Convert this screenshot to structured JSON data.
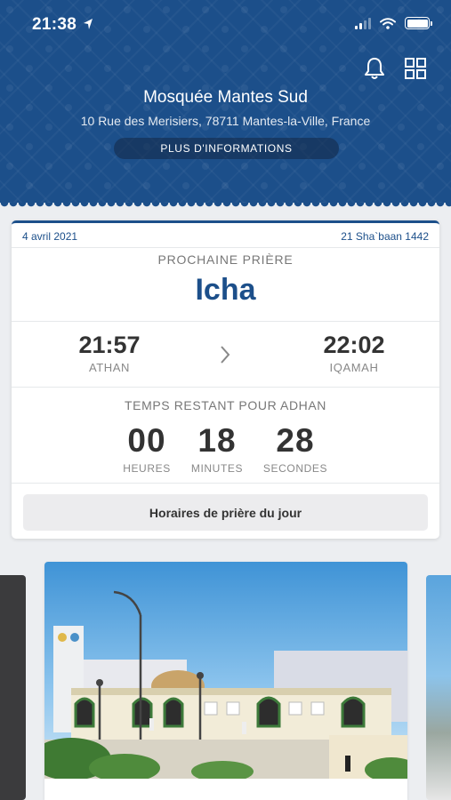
{
  "status_bar": {
    "time": "21:38"
  },
  "header": {
    "mosque_name": "Mosquée Mantes Sud",
    "address": "10 Rue des Merisiers, 78711 Mantes-la-Ville, France",
    "more_info_label": "PLUS D'INFORMATIONS",
    "icons": [
      "bell-icon",
      "grid-icon"
    ]
  },
  "prayer_card": {
    "gregorian_date": "4 avril 2021",
    "hijri_date": "21 Sha`baan 1442",
    "next_prayer_label": "PROCHAINE PRIÈRE",
    "next_prayer_name": "Icha",
    "athan_time": "21:57",
    "athan_label": "ATHAN",
    "iqamah_time": "22:02",
    "iqamah_label": "IQAMAH",
    "remaining_label": "TEMPS RESTANT POUR ADHAN",
    "countdown": [
      {
        "value": "00",
        "unit": "HEURES"
      },
      {
        "value": "18",
        "unit": "MINUTES"
      },
      {
        "value": "28",
        "unit": "SECONDES"
      }
    ],
    "day_schedule_button": "Horaires de prière du jour"
  },
  "colors": {
    "primary": "#1c4f8a",
    "background": "#eceef1"
  }
}
